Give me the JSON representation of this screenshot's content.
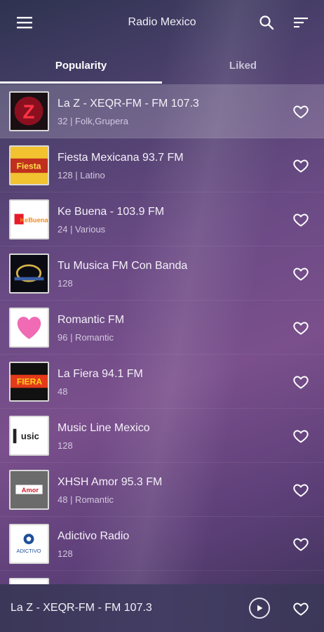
{
  "app_bar": {
    "title": "Radio Mexico",
    "menu_icon": "hamburger-menu-icon",
    "search_icon": "search-icon",
    "sort_icon": "sort-icon"
  },
  "tabs": [
    {
      "label": "Popularity",
      "active": true
    },
    {
      "label": "Liked",
      "active": false
    }
  ],
  "stations": [
    {
      "name": "La Z - XEQR-FM - FM 107.3",
      "meta": "32 | Folk,Grupera",
      "selected": true
    },
    {
      "name": "Fiesta Mexicana 93.7 FM",
      "meta": "128 | Latino"
    },
    {
      "name": "Ke Buena - 103.9 FM",
      "meta": "24 | Various"
    },
    {
      "name": "Tu Musica FM Con Banda",
      "meta": "128"
    },
    {
      "name": "Romantic FM",
      "meta": "96 | Romantic"
    },
    {
      "name": "La Fiera 94.1 FM",
      "meta": "48"
    },
    {
      "name": "Music Line Mexico",
      "meta": "128"
    },
    {
      "name": "XHSH Amor 95.3 FM",
      "meta": "48 | Romantic"
    },
    {
      "name": "Adictivo Radio",
      "meta": "128"
    }
  ],
  "logo_text": {
    "la_z": "Z",
    "fiesta": "Fiesta",
    "ke_buena": "KeBuena",
    "la_fiera": "FIERA",
    "music_line": "usic",
    "amor": "Amor",
    "adictivo": "ADICTIVO"
  },
  "player": {
    "now_playing": "La Z - XEQR-FM - FM 107.3",
    "play_icon": "play-icon",
    "favorite_icon": "heart-outline-icon"
  },
  "colors": {
    "accent": "#ffffff",
    "background_top": "#2e3350",
    "background_mid": "#7a4f8c",
    "player_bar": "#3b3758"
  }
}
